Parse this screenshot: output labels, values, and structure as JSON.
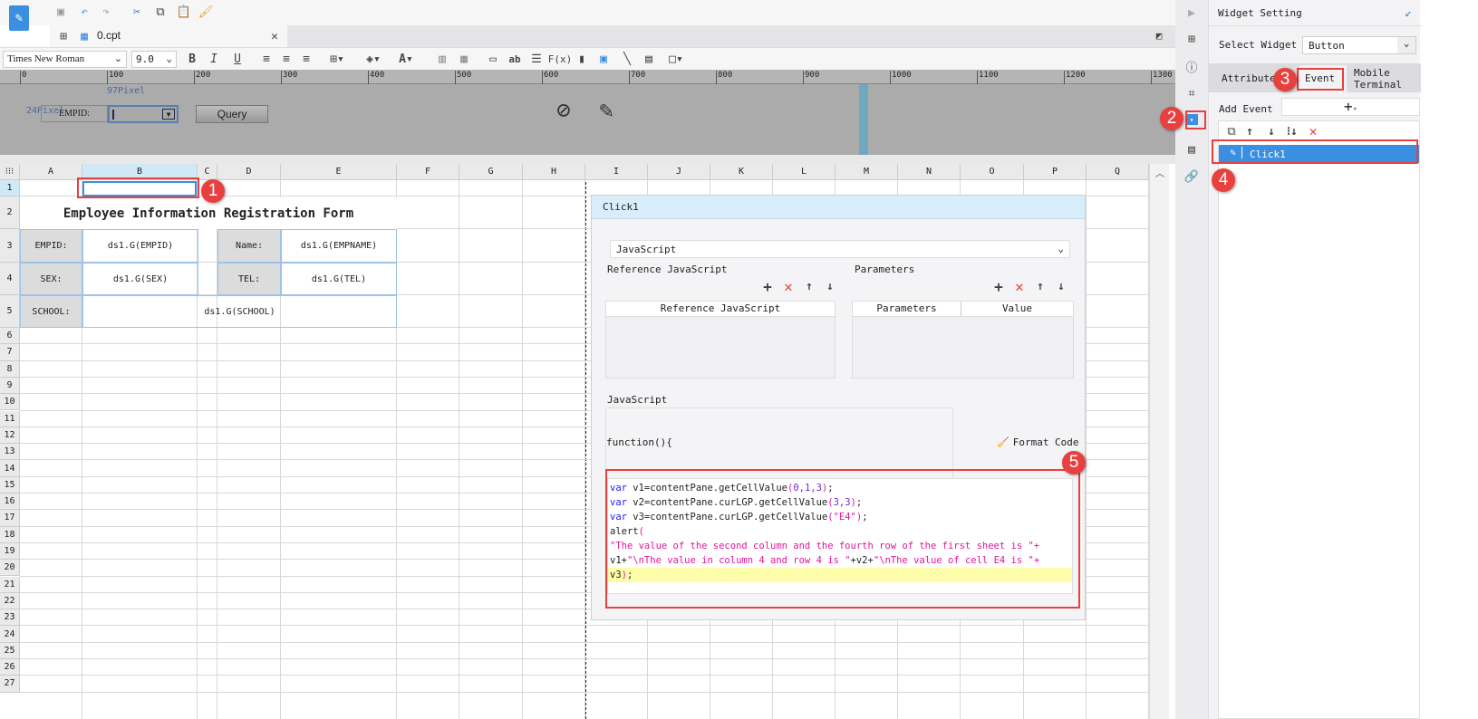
{
  "app": {
    "tab_label": "0.cpt"
  },
  "format": {
    "font_name": "Times New Roman",
    "font_size": "9.0"
  },
  "ruler": {
    "ticks": [
      "0",
      "100",
      "200",
      "300",
      "400",
      "500",
      "600",
      "700",
      "800",
      "900",
      "1000",
      "1100",
      "1200",
      "1300"
    ]
  },
  "design": {
    "width_label": "97Pixel",
    "height_label": "24Pixel",
    "empid_label": "EMPID:",
    "query_button": "Query"
  },
  "grid": {
    "columns": [
      "A",
      "B",
      "C",
      "D",
      "E",
      "F",
      "G",
      "H",
      "I",
      "J",
      "K",
      "L",
      "M",
      "N",
      "O",
      "P",
      "Q"
    ],
    "rows": [
      "1",
      "2",
      "3",
      "4",
      "5",
      "6",
      "7",
      "8",
      "9",
      "10",
      "11",
      "12",
      "13",
      "14",
      "15",
      "16",
      "17",
      "18",
      "19",
      "20",
      "21",
      "22",
      "23",
      "24",
      "25",
      "26",
      "27"
    ],
    "title": "Employee Information Registration Form",
    "empid_label": "EMPID:",
    "empid_value": "ds1.G(EMPID)",
    "name_label": "Name:",
    "name_value": "ds1.G(EMPNAME)",
    "sex_label": "SEX:",
    "sex_value": "ds1.G(SEX)",
    "tel_label": "TEL:",
    "tel_value": "ds1.G(TEL)",
    "school_label": "SCHOOL:",
    "school_value": "ds1.G(SCHOOL)"
  },
  "dialog": {
    "title": "Click1",
    "type_select": "JavaScript",
    "ref_js_section": "Reference JavaScript",
    "params_section": "Parameters",
    "ref_js_col": "Reference JavaScript",
    "params_col": "Parameters",
    "value_col": "Value",
    "js_section": "JavaScript",
    "function_header": "function(){",
    "format_code": "Format Code",
    "code": {
      "l1a": "var",
      " l1b": "",
      "v1": " v1=contentPane.getCellValue",
      "v1args": "0,1,3",
      "v2": " v2=contentPane.curLGP.getCellValue",
      "v2args": "3,3",
      "v3": " v3=contentPane.curLGP.getCellValue",
      "v3args": "\"E4\"",
      "alert": "alert",
      "s1": "\"The value of the second column and the fourth row of the first sheet is \"+",
      "s2a": "v1+",
      "s2b": "\"\\nThe value in column 4 and row 4 is \"",
      "s2c": "+v2+",
      "s2d": "\"\\nThe value of cell E4 is \"+",
      "s3": "v3"
    }
  },
  "panel": {
    "title": "Widget Setting",
    "select_widget_label": "Select Widget",
    "select_widget_value": "Button",
    "tabs": [
      "Attribute",
      "Event",
      "Mobile Terminal"
    ],
    "add_event_label": "Add Event",
    "events": [
      "Click1"
    ]
  },
  "badges": [
    "1",
    "2",
    "3",
    "4",
    "5"
  ],
  "colors": {
    "accent": "#3b8fe0",
    "annotation": "#e8403f",
    "selection": "#3b8fe0"
  }
}
